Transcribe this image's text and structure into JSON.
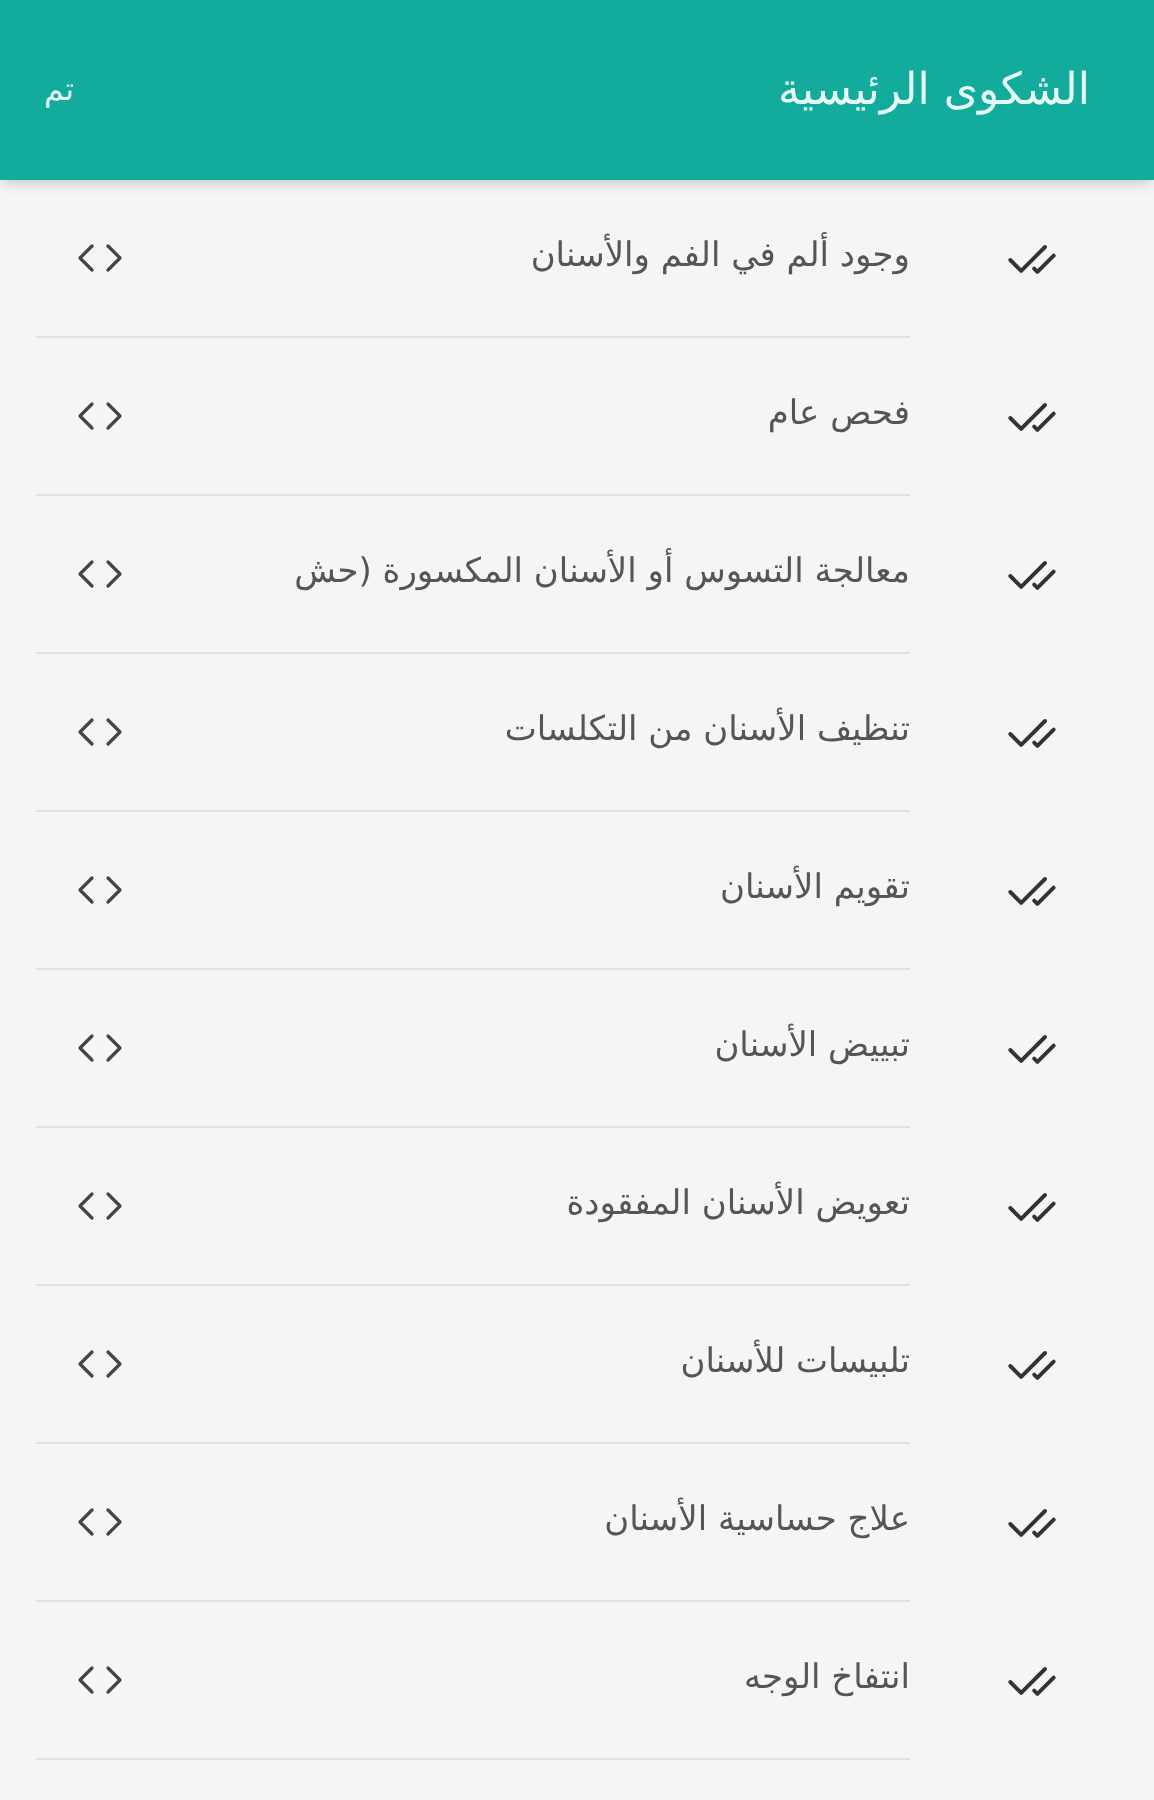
{
  "header": {
    "title": "الشكوى الرئيسية",
    "done_button": "تم"
  },
  "items": [
    {
      "label": "وجود ألم في الفم والأسنان"
    },
    {
      "label": "فحص عام"
    },
    {
      "label": "معالجة التسوس أو الأسنان المكسورة (حش"
    },
    {
      "label": "تنظيف الأسنان من التكلسات"
    },
    {
      "label": "تقويم الأسنان"
    },
    {
      "label": "تبييض الأسنان"
    },
    {
      "label": "تعويض الأسنان المفقودة"
    },
    {
      "label": "تلبيسات للأسنان"
    },
    {
      "label": "علاج حساسية الأسنان"
    },
    {
      "label": "انتفاخ الوجه"
    }
  ]
}
